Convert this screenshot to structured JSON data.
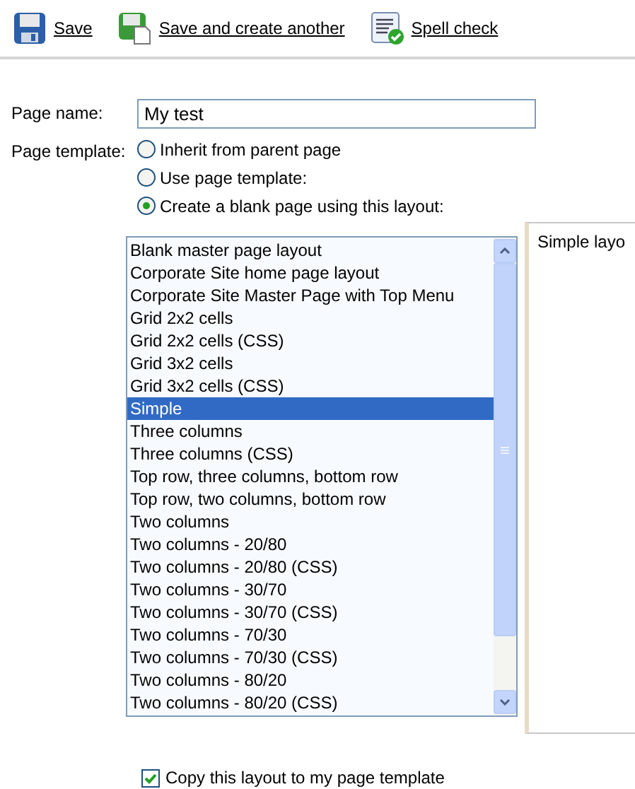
{
  "toolbar": [
    {
      "kind": "save",
      "label": "Save"
    },
    {
      "kind": "save-new",
      "label": "Save and create another"
    },
    {
      "kind": "spell",
      "label": "Spell check"
    }
  ],
  "page_name": {
    "label": "Page name:",
    "value": "My test"
  },
  "page_template": {
    "label": "Page template:",
    "options": [
      {
        "label": "Inherit from parent page",
        "selected": false
      },
      {
        "label": "Use page template:",
        "selected": false
      },
      {
        "label": "Create a blank page using this layout:",
        "selected": true
      }
    ]
  },
  "layouts": [
    {
      "label": "Blank master page layout",
      "selected": false
    },
    {
      "label": "Corporate Site home page layout",
      "selected": false
    },
    {
      "label": "Corporate Site Master Page with Top Menu",
      "selected": false
    },
    {
      "label": "Grid 2x2 cells",
      "selected": false
    },
    {
      "label": "Grid 2x2 cells (CSS)",
      "selected": false
    },
    {
      "label": "Grid 3x2 cells",
      "selected": false
    },
    {
      "label": "Grid 3x2 cells (CSS)",
      "selected": false
    },
    {
      "label": "Simple",
      "selected": true
    },
    {
      "label": "Three columns",
      "selected": false
    },
    {
      "label": "Three columns (CSS)",
      "selected": false
    },
    {
      "label": "Top row, three columns, bottom row",
      "selected": false
    },
    {
      "label": "Top row, two columns, bottom row",
      "selected": false
    },
    {
      "label": "Two columns",
      "selected": false
    },
    {
      "label": "Two columns - 20/80",
      "selected": false
    },
    {
      "label": "Two columns - 20/80 (CSS)",
      "selected": false
    },
    {
      "label": "Two columns - 30/70",
      "selected": false
    },
    {
      "label": "Two columns - 30/70 (CSS)",
      "selected": false
    },
    {
      "label": "Two columns - 70/30",
      "selected": false
    },
    {
      "label": "Two columns - 70/30 (CSS)",
      "selected": false
    },
    {
      "label": "Two columns - 80/20",
      "selected": false
    },
    {
      "label": "Two columns - 80/20 (CSS)",
      "selected": false
    }
  ],
  "preview": {
    "text": "Simple layo"
  },
  "copy_layout": {
    "label": "Copy this layout to my page template",
    "checked": true
  }
}
